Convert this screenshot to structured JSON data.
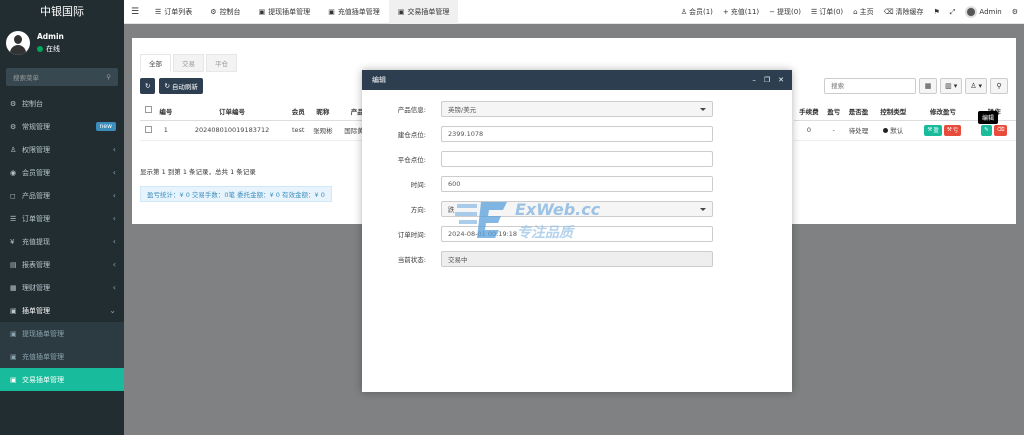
{
  "sidebar": {
    "brand": "中银国际",
    "user": {
      "name": "Admin",
      "status": "在线"
    },
    "search_placeholder": "搜索菜单",
    "menu": [
      {
        "label": "控制台",
        "icon": "dashboard-icon"
      },
      {
        "label": "常规管理",
        "icon": "cogs-icon",
        "badge": "new"
      },
      {
        "label": "权限管理",
        "icon": "group-icon"
      },
      {
        "label": "会员管理",
        "icon": "user-circle-icon"
      },
      {
        "label": "产品管理",
        "icon": "product-icon"
      },
      {
        "label": "订单管理",
        "icon": "list-icon"
      },
      {
        "label": "充值提现",
        "icon": "yen-icon"
      },
      {
        "label": "报表管理",
        "icon": "report-icon"
      },
      {
        "label": "理财管理",
        "icon": "finance-icon"
      },
      {
        "label": "插单管理",
        "icon": "square-icon"
      }
    ],
    "submenu": [
      {
        "label": "提现插单管理"
      },
      {
        "label": "充值插单管理"
      },
      {
        "label": "交易插单管理"
      }
    ]
  },
  "topbar": {
    "tabs": [
      {
        "label": "订单列表"
      },
      {
        "label": "控制台"
      },
      {
        "label": "提现插单管理"
      },
      {
        "label": "充值插单管理"
      },
      {
        "label": "交易插单管理"
      }
    ],
    "right": {
      "members": "会员(1)",
      "recharge": "充值(11)",
      "withdraw": "提现(0)",
      "orders": "订单(0)",
      "home": "主页",
      "clear_cache": "清除缓存",
      "admin": "Admin"
    }
  },
  "content": {
    "subtabs": [
      "全部",
      "交易",
      "平仓"
    ],
    "auto_refresh": "自动刷新",
    "search_placeholder": "搜索",
    "table": {
      "headers_left": [
        "编号",
        "订单编号",
        "会员",
        "昵称",
        "产品"
      ],
      "headers_right": [
        "手续费",
        "盈亏",
        "是否盈",
        "控制类型",
        "修改盈亏",
        "操作"
      ],
      "row": {
        "id": "1",
        "order_no": "202408010019183712",
        "member": "test",
        "nickname": "张观彬",
        "product": "国际黄金",
        "fee": "0",
        "pnl": "-",
        "is_profit": "待处理",
        "control": "默认",
        "win_label": "盈",
        "loss_label": "亏"
      }
    },
    "pager_info": "显示第 1 到第 1 条记录，总共 1 条记录",
    "stats": "盈亏统计：¥ 0 交易手数：0笔 委托金额：¥ 0 有效金额：¥ 0",
    "tooltip": "编辑"
  },
  "modal": {
    "title": "编辑",
    "fields": [
      {
        "label": "产品信息:",
        "value": "英镑/美元",
        "type": "select"
      },
      {
        "label": "建仓点位:",
        "value": "2399.1078",
        "type": "input"
      },
      {
        "label": "平仓点位:",
        "value": "",
        "type": "input"
      },
      {
        "label": "时间:",
        "value": "600",
        "type": "input"
      },
      {
        "label": "方向:",
        "value": "跌",
        "type": "select"
      },
      {
        "label": "订单时间:",
        "value": "2024-08-01 00:19:18",
        "type": "input"
      },
      {
        "label": "当前状态:",
        "value": "交易中",
        "type": "readonly"
      }
    ]
  },
  "watermark": {
    "line1": "ExWeb.cc",
    "line2": "专注品质"
  }
}
